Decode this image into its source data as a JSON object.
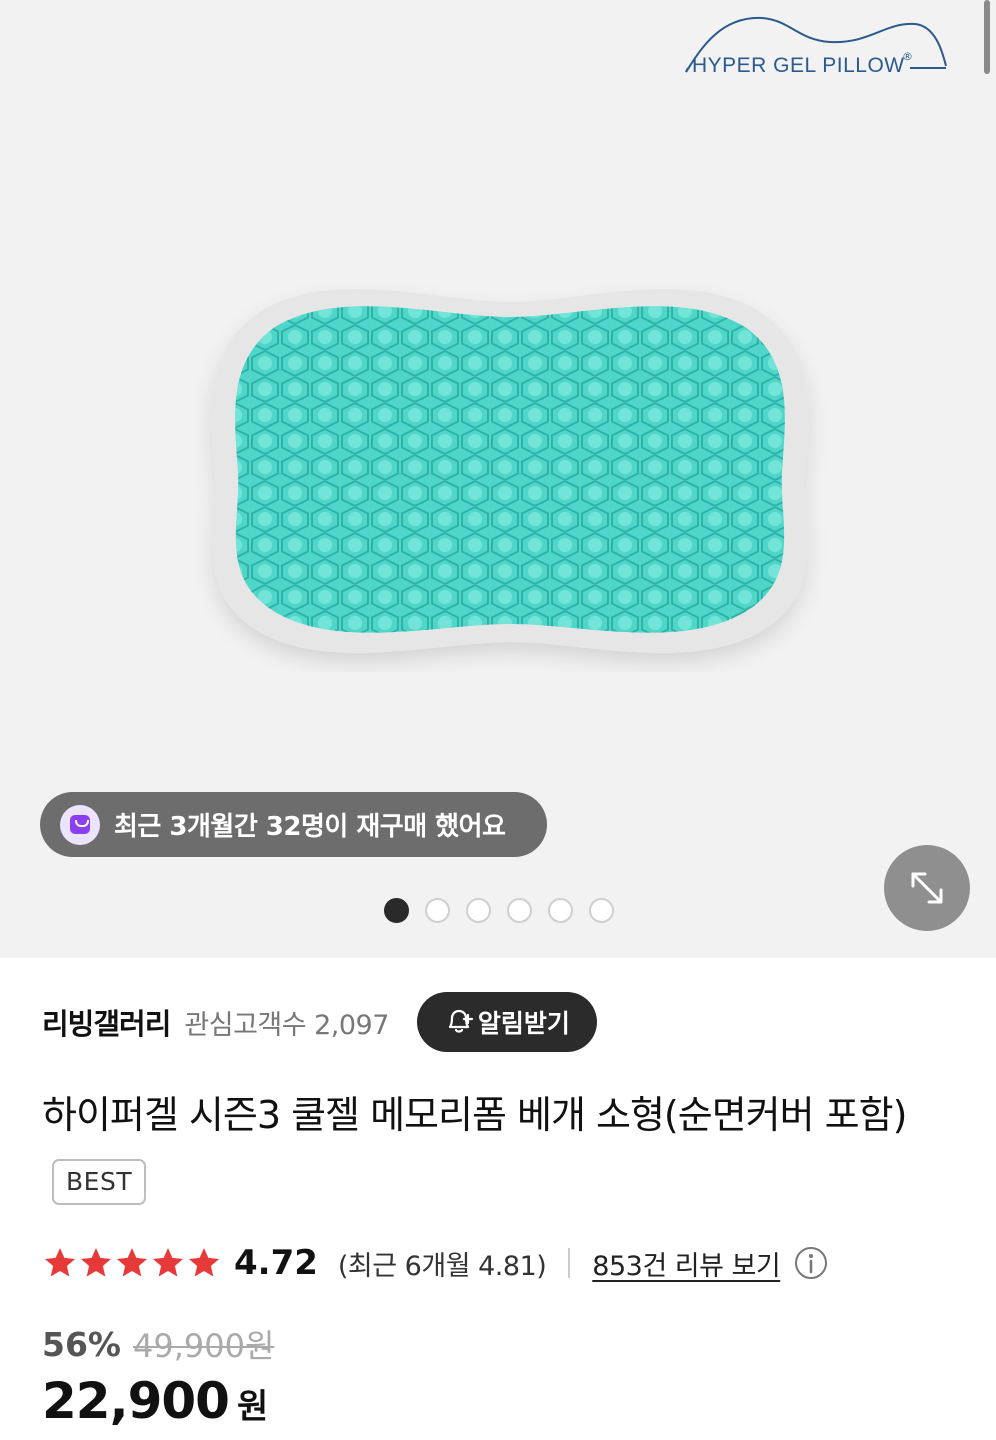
{
  "brand_logo": {
    "text": "HYPER GEL PILLOW",
    "registered": "®"
  },
  "repurchase_banner": {
    "text": "최근 3개월간 32명이 재구매 했어요",
    "icon": "shopping-bag-icon"
  },
  "gallery": {
    "total_images": 6,
    "active_index": 0
  },
  "seller": {
    "name": "리빙갤러리",
    "follower_label": "관심고객수",
    "follower_count": "2,097",
    "alarm_label": "알림받기"
  },
  "product": {
    "title": "하이퍼겔 시즌3 쿨젤 메모리폼 베개 소형(순면커버 포함)",
    "badge": "BEST"
  },
  "rating": {
    "score": "4.72",
    "stars": 5,
    "recent_text": "(최근 6개월 4.81)",
    "review_link": "853건 리뷰 보기"
  },
  "price": {
    "discount": "56%",
    "original": "49,900원",
    "sale": "22,900",
    "currency": "원"
  },
  "colors": {
    "star": "#e8393a",
    "gel": "#4fd6c8",
    "banner_bg": "#6d6d6d",
    "button_dark": "#2b2b2b",
    "accent_purple": "#8b3ff0"
  }
}
